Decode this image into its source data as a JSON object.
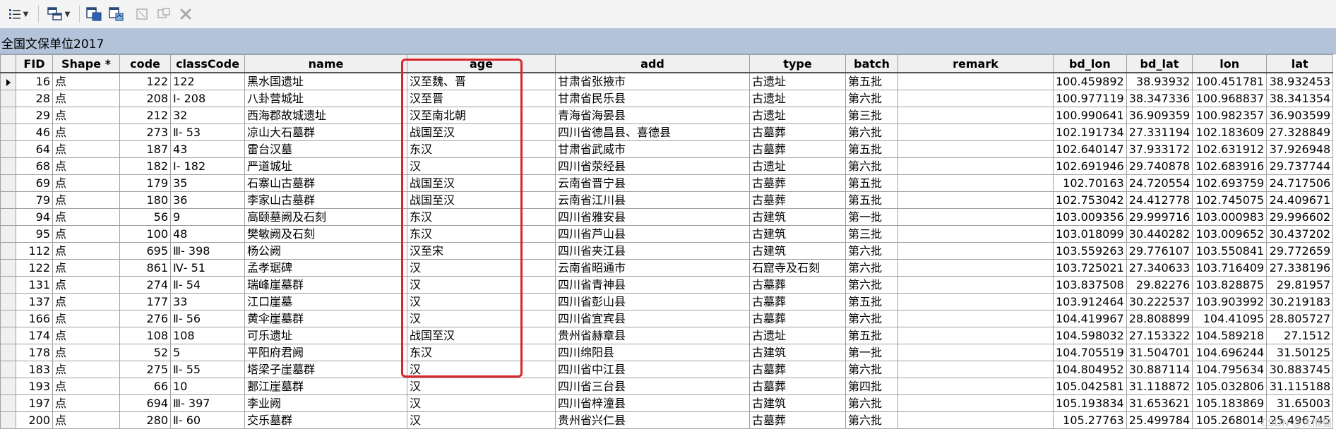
{
  "toolbar": {
    "buttons": [
      {
        "icon": "table-options-icon",
        "has_dropdown": true
      },
      {
        "icon": "related-tables-icon",
        "has_dropdown": true
      },
      {
        "icon": "select-by-attributes-icon"
      },
      {
        "icon": "switch-selection-icon"
      },
      {
        "icon": "clear-selection-icon"
      },
      {
        "icon": "zoom-to-selected-icon"
      },
      {
        "icon": "delete-selected-icon"
      }
    ]
  },
  "title": "全国文保单位2017",
  "columns": [
    "FID",
    "Shape *",
    "code",
    "classCode",
    "name",
    "age",
    "add",
    "type",
    "batch",
    "remark",
    "bd_lon",
    "bd_lat",
    "lon",
    "lat"
  ],
  "rows": [
    [
      "16",
      "点",
      "122",
      "122",
      "黑水国遗址",
      "汉至魏、晋",
      "甘肃省张掖市",
      "古遗址",
      "第五批",
      "",
      "100.459892",
      "38.93932",
      "100.451781",
      "38.932453"
    ],
    [
      "28",
      "点",
      "208",
      "Ⅰ- 208",
      "八卦营城址",
      "汉至晋",
      "甘肃省民乐县",
      "古遗址",
      "第六批",
      "",
      "100.977119",
      "38.347336",
      "100.968837",
      "38.341354"
    ],
    [
      "29",
      "点",
      "212",
      "32",
      "西海郡故城遗址",
      "汉至南北朝",
      "青海省海晏县",
      "古遗址",
      "第三批",
      "",
      "100.990641",
      "36.909359",
      "100.982357",
      "36.903599"
    ],
    [
      "46",
      "点",
      "273",
      "Ⅱ- 53",
      "凉山大石墓群",
      "战国至汉",
      "四川省德昌县、喜德县",
      "古墓葬",
      "第六批",
      "",
      "102.191734",
      "27.331194",
      "102.183609",
      "27.328849"
    ],
    [
      "64",
      "点",
      "187",
      "43",
      "雷台汉墓",
      "东汉",
      "甘肃省武威市",
      "古墓葬",
      "第五批",
      "",
      "102.640147",
      "37.933172",
      "102.631912",
      "37.926948"
    ],
    [
      "68",
      "点",
      "182",
      "Ⅰ- 182",
      "严道城址",
      "汉",
      "四川省荥经县",
      "古遗址",
      "第六批",
      "",
      "102.691946",
      "29.740878",
      "102.683916",
      "29.737744"
    ],
    [
      "69",
      "点",
      "179",
      "35",
      "石寨山古墓群",
      "战国至汉",
      "云南省晋宁县",
      "古墓葬",
      "第五批",
      "",
      "102.70163",
      "24.720554",
      "102.693759",
      "24.717506"
    ],
    [
      "79",
      "点",
      "180",
      "36",
      "李家山古墓群",
      "战国至汉",
      "云南省江川县",
      "古墓葬",
      "第五批",
      "",
      "102.753042",
      "24.412778",
      "102.745075",
      "24.409671"
    ],
    [
      "94",
      "点",
      "56",
      "9",
      "高颐墓阙及石刻",
      "东汉",
      "四川省雅安县",
      "古建筑",
      "第一批",
      "",
      "103.009356",
      "29.999716",
      "103.000983",
      "29.996602"
    ],
    [
      "95",
      "点",
      "100",
      "48",
      "樊敏阙及石刻",
      "东汉",
      "四川省芦山县",
      "古建筑",
      "第三批",
      "",
      "103.018099",
      "30.440282",
      "103.009652",
      "30.437202"
    ],
    [
      "112",
      "点",
      "695",
      "Ⅲ- 398",
      "杨公阙",
      "汉至宋",
      "四川省夹江县",
      "古建筑",
      "第六批",
      "",
      "103.559263",
      "29.776107",
      "103.550841",
      "29.772659"
    ],
    [
      "122",
      "点",
      "861",
      "Ⅳ- 51",
      "孟孝琚碑",
      "汉",
      "云南省昭通市",
      "石窟寺及石刻",
      "第六批",
      "",
      "103.725021",
      "27.340633",
      "103.716409",
      "27.338196"
    ],
    [
      "131",
      "点",
      "274",
      "Ⅱ- 54",
      "瑞峰崖墓群",
      "汉",
      "四川省青神县",
      "古墓葬",
      "第六批",
      "",
      "103.837508",
      "29.82276",
      "103.828875",
      "29.81957"
    ],
    [
      "137",
      "点",
      "177",
      "33",
      "江口崖墓",
      "汉",
      "四川省彭山县",
      "古墓葬",
      "第五批",
      "",
      "103.912464",
      "30.222537",
      "103.903992",
      "30.219183"
    ],
    [
      "166",
      "点",
      "276",
      "Ⅱ- 56",
      "黄伞崖墓群",
      "汉",
      "四川省宜宾县",
      "古墓葬",
      "第六批",
      "",
      "104.419967",
      "28.808899",
      "104.41095",
      "28.805727"
    ],
    [
      "174",
      "点",
      "108",
      "108",
      "可乐遗址",
      "战国至汉",
      "贵州省赫章县",
      "古遗址",
      "第五批",
      "",
      "104.598032",
      "27.153322",
      "104.589218",
      "27.1512"
    ],
    [
      "178",
      "点",
      "52",
      "5",
      "平阳府君阙",
      "东汉",
      "四川绵阳县",
      "古建筑",
      "第一批",
      "",
      "104.705519",
      "31.504701",
      "104.696244",
      "31.50125"
    ],
    [
      "183",
      "点",
      "275",
      "Ⅱ- 55",
      "塔梁子崖墓群",
      "汉",
      "四川省中江县",
      "古墓葬",
      "第六批",
      "",
      "104.804952",
      "30.887114",
      "104.795634",
      "30.883745"
    ],
    [
      "193",
      "点",
      "66",
      "10",
      "郪江崖墓群",
      "汉",
      "四川省三台县",
      "古墓葬",
      "第四批",
      "",
      "105.042581",
      "31.118872",
      "105.032806",
      "31.115188"
    ],
    [
      "197",
      "点",
      "694",
      "Ⅲ- 397",
      "李业阙",
      "汉",
      "四川省梓潼县",
      "古建筑",
      "第六批",
      "",
      "105.193834",
      "31.653621",
      "105.183869",
      "31.65003"
    ],
    [
      "200",
      "点",
      "280",
      "Ⅱ- 60",
      "交乐墓群",
      "汉",
      "贵州省兴仁县",
      "古墓葬",
      "第六批",
      "",
      "105.27763",
      "25.499784",
      "105.268014",
      "25.496745"
    ]
  ],
  "watermark": "CSDN @大懒猫"
}
